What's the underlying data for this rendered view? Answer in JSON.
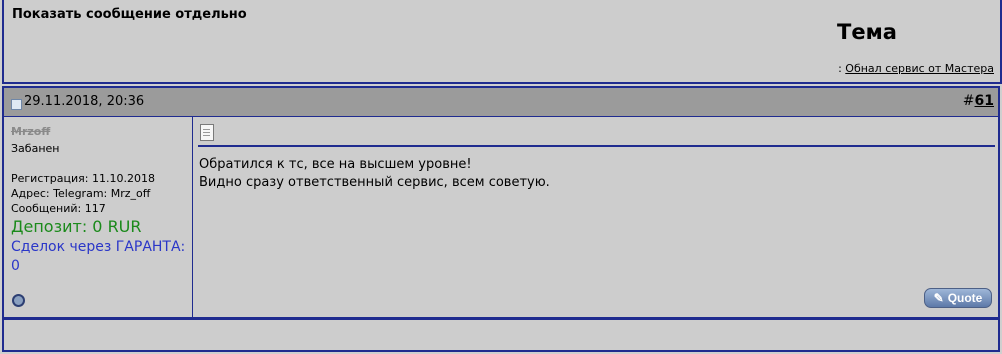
{
  "top": {
    "show_single": "Показать сообщение отдельно",
    "topic_heading": "Тема",
    "topic_prefix": ": ",
    "topic_link": "Обнал сервис от Мастера"
  },
  "post": {
    "date": "29.11.2018, 20:36",
    "number_prefix": "#",
    "number": "61",
    "user": {
      "name": "Mrzoff",
      "title": "Забанен",
      "registration": "Регистрация: 11.10.2018",
      "address": "Адрес: Telegram: Mrz_off",
      "messages": "Сообщений: 117",
      "deposit": "Депозит: 0 RUR",
      "guarantee": "Сделок через ГАРАНТА: 0"
    },
    "message_lines": [
      "Обратился к тс, все на высшем уровне!",
      "Видно сразу ответственный сервис, всем советую."
    ],
    "quote_button": "Quote"
  },
  "colors": {
    "border_blue": "#1f2b8f",
    "header_gray": "#9b9b9b",
    "deposit_green": "#1b8a1b",
    "guarantee_blue": "#2a36c8"
  }
}
